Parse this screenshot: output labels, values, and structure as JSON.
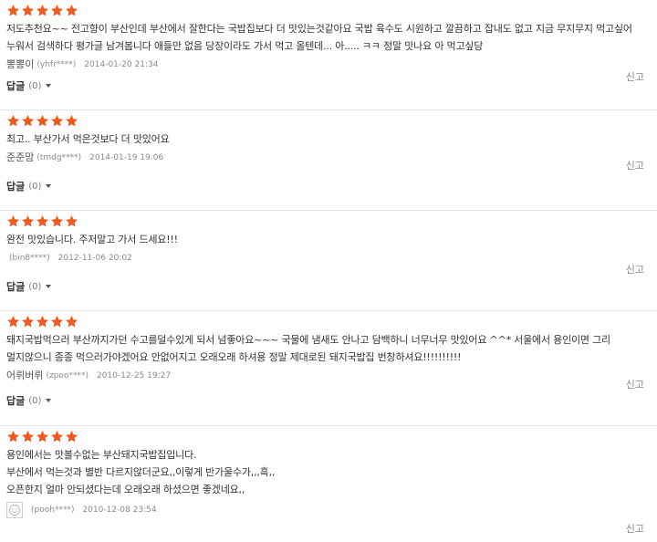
{
  "colors": {
    "star": "#f05a1a",
    "accent": "#f05a1a"
  },
  "reviews": [
    {
      "rating": 5,
      "text": "저도추천요~~ 전고향이 부산인데 부산에서 잘한다는 국밥집보다 더 맛있는것같아요 국밥 육수도 시원하고 깔끔하고 잡내도 없고 지금 무지무지 먹고싶어 누워서 검색하다 평가글 남겨봅니다 애들만 없음 당장이라도 가서 먹고 올텐데... 아..... ㅋㅋ 정말 맛나요 아 먹고싶당",
      "nickname": "뽕뽕이",
      "user_id": "(yhfr****)",
      "date": "2014-01-20 21:34",
      "report": "신고",
      "reply_label": "답글",
      "reply_count": "(0)"
    },
    {
      "rating": 5,
      "text": "최고.. 부산가서 먹은것보다 더 맛있어요",
      "nickname": "준준맘",
      "user_id": "(tmdg****)",
      "date": "2014-01-19 19:06",
      "report": "신고",
      "reply_label": "답글",
      "reply_count": "(0)"
    },
    {
      "rating": 5,
      "text": "완전 맛있습니다. 주저말고 가서 드세요!!!",
      "nickname": "",
      "user_id": "(bin8****)",
      "date": "2012-11-06 20:02",
      "report": "신고",
      "reply_label": "답글",
      "reply_count": "(0)"
    },
    {
      "rating": 5,
      "text": "돼지국밥먹으러 부산까지가던 수고를덜수있게 되서 넘좋아요~~~ 국물에 냄새도 안나고 담백하니 너무너무 맛있어요 ^^* 서울에서 용인이면 그리 멀지않으니 종종 먹으러가야겠어요 안없어지고 오래오래 하셔용 정말 제대로된 돼지국밥집 번창하셔요!!!!!!!!!!",
      "nickname": "어뤼버뤼",
      "user_id": "(zpoo****)",
      "date": "2010-12-25 19:27",
      "report": "신고",
      "reply_label": "답글",
      "reply_count": "(0)"
    },
    {
      "rating": 5,
      "text_lines": [
        "용인에서는 맛볼수없는 부산돼지국밥집입니다.",
        "부산에서 먹는것과 별반 다르지않더군요,,이렇게 반가울수가,,,흑,,",
        "오픈한지 얼마 안되셨다는데 오래오래 하셨으면 좋겠네요,,"
      ],
      "nickname": "",
      "user_id": "(pooh****)",
      "date": "2010-12-08 23:54",
      "report": "신고",
      "avatar_icon": "smiley-icon"
    }
  ]
}
